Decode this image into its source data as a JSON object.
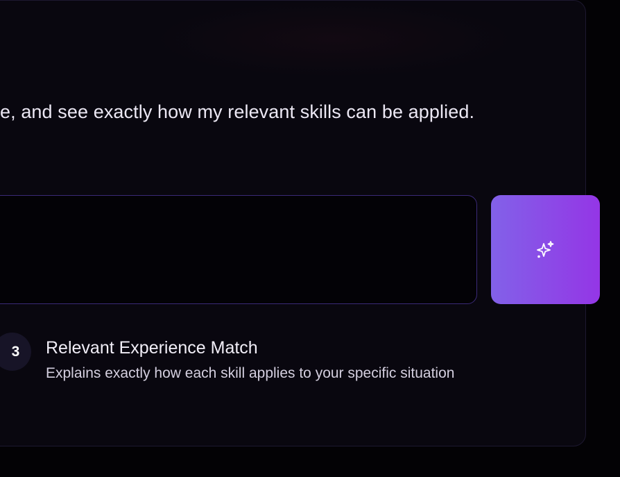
{
  "main": {
    "description": "e, and see exactly how my relevant skills can be applied.",
    "input": {
      "value": "",
      "placeholder": ""
    },
    "generate_button": {
      "icon": "sparkles-icon",
      "gradient_start": "#8261e8",
      "gradient_end": "#9436e6"
    },
    "steps": [
      {
        "number": "3",
        "title": "Relevant Experience Match",
        "description": "Explains exactly how each skill applies to your specific situation"
      }
    ]
  },
  "theme": {
    "background": "#030205",
    "card_background": "#09070f",
    "input_border": "#3b2a78"
  }
}
